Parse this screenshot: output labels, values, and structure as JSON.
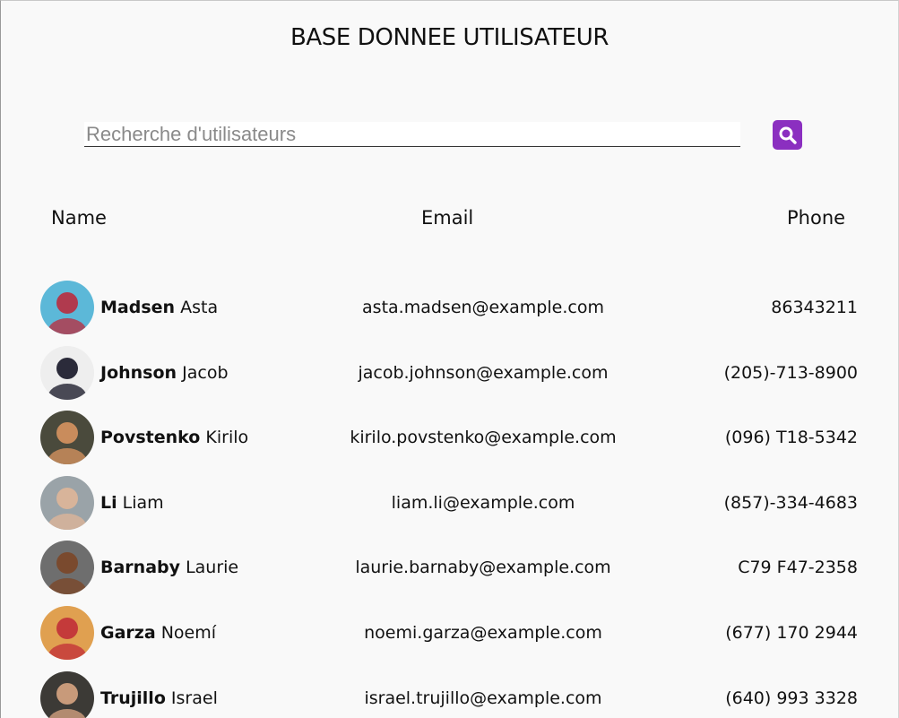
{
  "page_title": "BASE DONNEE UTILISATEUR",
  "search": {
    "placeholder": "Recherche d'utilisateurs",
    "value": "",
    "button_icon": "search-icon",
    "button_color": "#8b2fc0"
  },
  "columns": {
    "name": "Name",
    "email": "Email",
    "phone": "Phone"
  },
  "users": [
    {
      "last": "Madsen",
      "first": "Asta",
      "email": "asta.madsen@example.com",
      "phone": "86343211",
      "avatar_bg": "#5cb8d8",
      "avatar_fg": "#b03a4e"
    },
    {
      "last": "Johnson",
      "first": "Jacob",
      "email": "jacob.johnson@example.com",
      "phone": "(205)-713-8900",
      "avatar_bg": "#eeeeee",
      "avatar_fg": "#2b2b3a"
    },
    {
      "last": "Povstenko",
      "first": "Kirilo",
      "email": "kirilo.povstenko@example.com",
      "phone": "(096) T18-5342",
      "avatar_bg": "#4a4a3c",
      "avatar_fg": "#c98c5c"
    },
    {
      "last": "Li",
      "first": "Liam",
      "email": "liam.li@example.com",
      "phone": "(857)-334-4683",
      "avatar_bg": "#9aa3a8",
      "avatar_fg": "#d8b49a"
    },
    {
      "last": "Barnaby",
      "first": "Laurie",
      "email": "laurie.barnaby@example.com",
      "phone": "C79 F47-2358",
      "avatar_bg": "#6e6e6e",
      "avatar_fg": "#7a4a2e"
    },
    {
      "last": "Garza",
      "first": "Noemí",
      "email": "noemi.garza@example.com",
      "phone": "(677) 170 2944",
      "avatar_bg": "#e0a050",
      "avatar_fg": "#c43a3a"
    },
    {
      "last": "Trujillo",
      "first": "Israel",
      "email": "israel.trujillo@example.com",
      "phone": "(640) 993 3328",
      "avatar_bg": "#3c3a36",
      "avatar_fg": "#c89a7a"
    }
  ]
}
